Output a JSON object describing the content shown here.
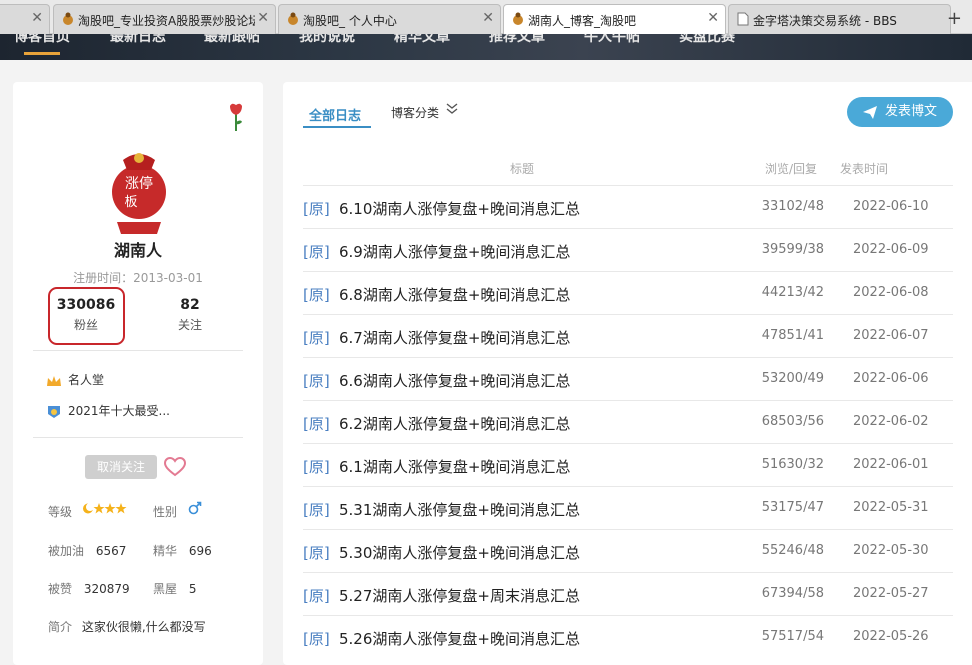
{
  "browser": {
    "tabs": [
      {
        "title": "",
        "active": false
      },
      {
        "title": "淘股吧_专业投资A股股票炒股论坛",
        "active": false
      },
      {
        "title": "淘股吧_ 个人中心",
        "active": false
      },
      {
        "title": "湖南人_博客_淘股吧",
        "active": true
      },
      {
        "title": "金字塔决策交易系统 - BBS",
        "active": false
      }
    ],
    "new_tab": "+"
  },
  "nav": {
    "items": [
      "博客首页",
      "最新日志",
      "最新跟帖",
      "我的说说",
      "精华文章",
      "推荐文章",
      "牛人牛帖",
      "实盘比赛"
    ]
  },
  "profile": {
    "name": "湖南人",
    "register_time": "注册时间：2013-03-01",
    "fans_count": "330086",
    "fans_label": "粉丝",
    "follow_count": "82",
    "follow_label": "关注",
    "honors": [
      "名人堂",
      "2021年十大最受..."
    ],
    "unfollow_label": "取消关注",
    "level_label": "等级",
    "gender_label": "性别",
    "gender_icon": "male-icon",
    "cheered_label": "被加油",
    "cheered_value": "6567",
    "elite_label": "精华",
    "elite_value": "696",
    "liked_label": "被赞",
    "liked_value": "320879",
    "blackroom_label": "黑屋",
    "blackroom_value": "5",
    "intro_label": "简介",
    "intro_value": "这家伙很懒,什么都没写",
    "accent_color": "#c8262b"
  },
  "blog": {
    "tab_all": "全部日志",
    "tab_category": "博客分类",
    "post_button": "发表博文",
    "headers": {
      "title": "标题",
      "views": "浏览/回复",
      "time": "发表时间"
    },
    "rows": [
      {
        "tag": "[原]",
        "title": "6.10湖南人涨停复盘+晚间消息汇总",
        "views": "33102/48",
        "date": "2022-06-10"
      },
      {
        "tag": "[原]",
        "title": "6.9湖南人涨停复盘+晚间消息汇总",
        "views": "39599/38",
        "date": "2022-06-09"
      },
      {
        "tag": "[原]",
        "title": "6.8湖南人涨停复盘+晚间消息汇总",
        "views": "44213/42",
        "date": "2022-06-08"
      },
      {
        "tag": "[原]",
        "title": "6.7湖南人涨停复盘+晚间消息汇总",
        "views": "47851/41",
        "date": "2022-06-07"
      },
      {
        "tag": "[原]",
        "title": "6.6湖南人涨停复盘+晚间消息汇总",
        "views": "53200/49",
        "date": "2022-06-06"
      },
      {
        "tag": "[原]",
        "title": "6.2湖南人涨停复盘+晚间消息汇总",
        "views": "68503/56",
        "date": "2022-06-02"
      },
      {
        "tag": "[原]",
        "title": "6.1湖南人涨停复盘+晚间消息汇总",
        "views": "51630/32",
        "date": "2022-06-01"
      },
      {
        "tag": "[原]",
        "title": "5.31湖南人涨停复盘+晚间消息汇总",
        "views": "53175/47",
        "date": "2022-05-31"
      },
      {
        "tag": "[原]",
        "title": "5.30湖南人涨停复盘+晚间消息汇总",
        "views": "55246/48",
        "date": "2022-05-30"
      },
      {
        "tag": "[原]",
        "title": "5.27湖南人涨停复盘+周末消息汇总",
        "views": "67394/58",
        "date": "2022-05-27"
      },
      {
        "tag": "[原]",
        "title": "5.26湖南人涨停复盘+晚间消息汇总",
        "views": "57517/54",
        "date": "2022-05-26"
      }
    ]
  }
}
